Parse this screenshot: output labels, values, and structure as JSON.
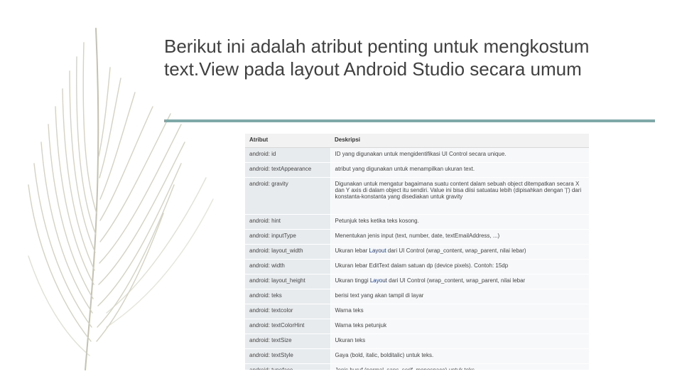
{
  "slide": {
    "title_line1": "Berikut ini adalah atribut penting untuk mengkostum",
    "title_line2": "text.View pada layout Android Studio secara umum"
  },
  "table": {
    "headers": [
      "Atribut",
      "Deskripsi"
    ],
    "rows": [
      {
        "attr": "android: id",
        "desc": "ID yang digunakan untuk mengidentifikasi UI Control secara unique."
      },
      {
        "attr": "android: textAppearance",
        "desc": "atribut yang digunakan untuk menampilkan ukuran text."
      },
      {
        "attr": "android: gravity",
        "desc": "Digunakan untuk mengatur bagaimana suatu content dalam sebuah object ditempatkan secara X dan Y axis di dalam object itu sendiri. Value ini bisa diisi satuatau lebih (dipisahkan dengan '|') dari konstanta-konstanta yang disediakan untuk gravity"
      },
      {
        "attr": "android: hint",
        "desc": "Petunjuk teks ketika teks kosong."
      },
      {
        "attr": "android: inputType",
        "desc": "Menentukan jenis input (text, number, date, textEmailAddress, ...)"
      },
      {
        "attr": "android: layout_width",
        "desc_pre": "Ukuran lebar ",
        "desc_hl": "Layout",
        "desc_post": " dari UI Control (wrap_content, wrap_parent, nilai lebar)"
      },
      {
        "attr": "android: width",
        "desc": "Ukuran lebar EditText dalam satuan dp (device pixels). Contoh: 15dp"
      },
      {
        "attr": "android: layout_height",
        "desc_pre": "Ukuran tinggi ",
        "desc_hl": "Layout",
        "desc_post": " dari UI Control (wrap_content, wrap_parent, nilai lebar"
      },
      {
        "attr": "android: teks",
        "desc": "berisi text yang akan tampil di layar"
      },
      {
        "attr": "android: textcolor",
        "desc": "Warna teks"
      },
      {
        "attr": "android: textColorHint",
        "desc": "Warna teks petunjuk"
      },
      {
        "attr": "android: textSize",
        "desc": "Ukuran teks"
      },
      {
        "attr": "android: textStyle",
        "desc": "Gaya (bold, italic, bolditalic) untuk teks."
      },
      {
        "attr": "android: typeface",
        "desc": "Jenis huruf (normal, sans, serif, monospace) untuk teks"
      }
    ]
  },
  "colors": {
    "accent_rule": "#7fa9a9",
    "feather": "#c9c8b6",
    "link_text": "#1f3a7a"
  }
}
